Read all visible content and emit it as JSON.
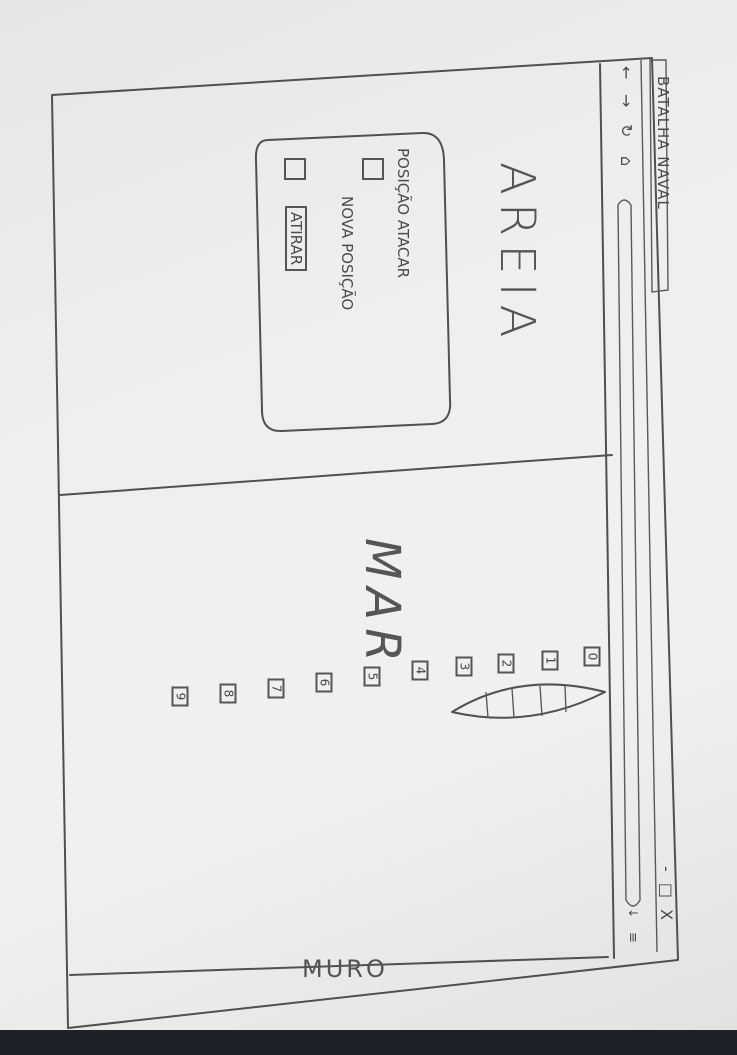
{
  "window": {
    "title": "BATALHA NAVAL",
    "controls": [
      "-",
      "□",
      "X"
    ]
  },
  "browser": {
    "nav_icons": [
      "back-arrow-icon",
      "forward-arrow-icon",
      "refresh-icon",
      "home-icon"
    ]
  },
  "areia": {
    "title": "AREIA",
    "panel": {
      "option1_label": "POSIÇÃO ATACAR",
      "option2_label": "NOVA POSIÇÃO",
      "fire_button": "ATIRAR"
    }
  },
  "mar": {
    "title": "MAR",
    "grid_numbers": [
      "0",
      "1",
      "2",
      "3",
      "4",
      "5",
      "6",
      "7",
      "8",
      "9"
    ]
  },
  "footer": {
    "label": "MURO"
  },
  "colors": {
    "ink": "#505050",
    "paper": "#eeeeec",
    "background": "#1f2128"
  }
}
